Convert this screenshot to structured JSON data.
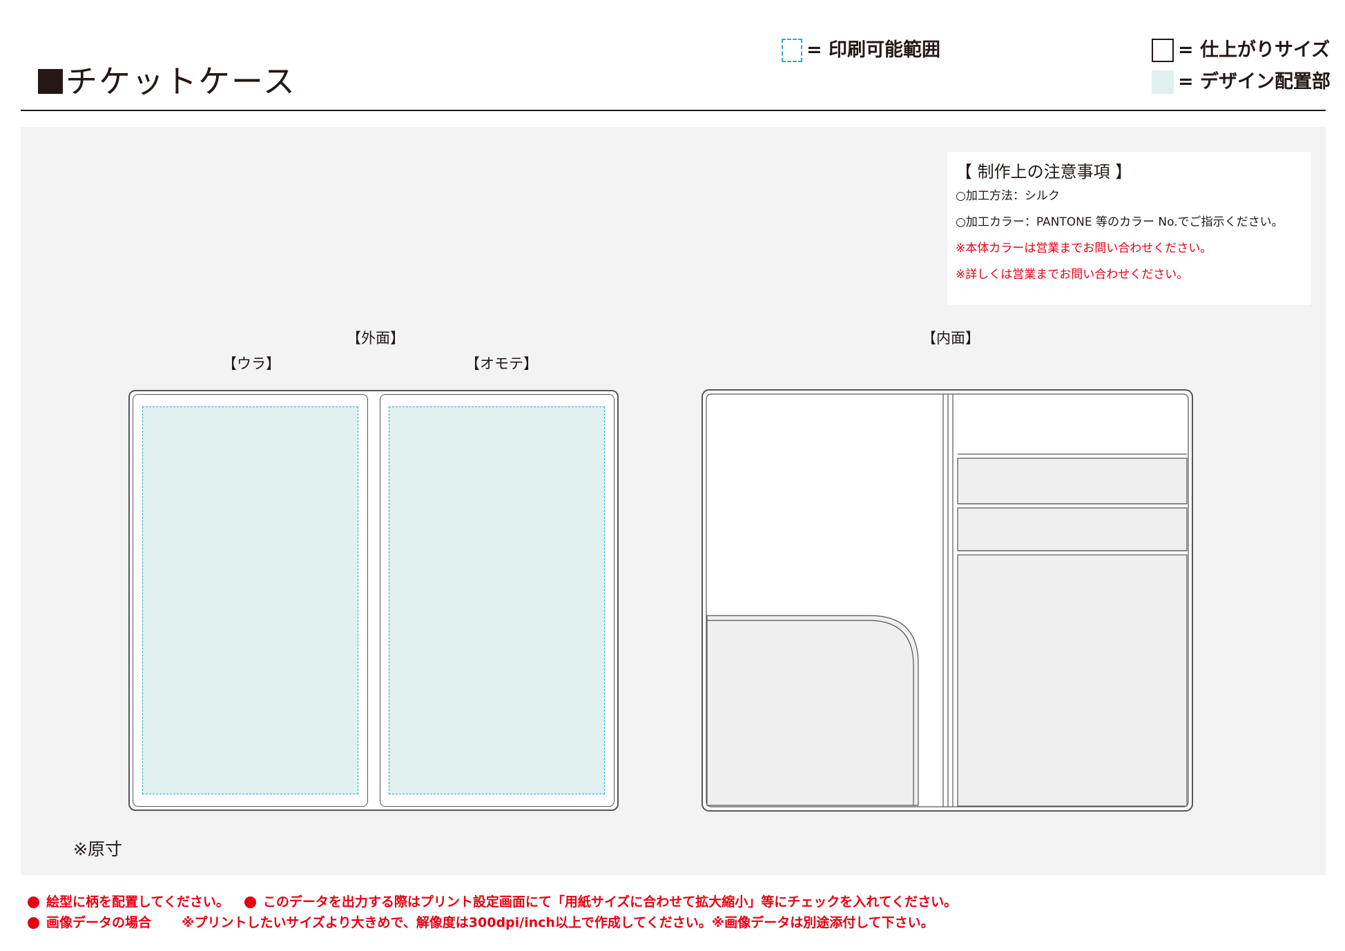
{
  "header": {
    "title": "チケットケース"
  },
  "legend": {
    "print_area": "= 印刷可能範囲",
    "finish_size": "= 仕上がりサイズ",
    "design_area": "= デザイン配置部"
  },
  "notes": {
    "title": "【 制作上の注意事項 】",
    "lines": [
      "○加工方法：シルク",
      "○加工カラー：PANTONE 等のカラー No.でご指示ください。"
    ],
    "warnings": [
      "※本体カラーは営業までお問い合わせください。",
      "※詳しくは営業までお問い合わせください。"
    ]
  },
  "labels": {
    "outer": "【外面】",
    "back": "【ウラ】",
    "front": "【オモテ】",
    "inner": "【内面】",
    "actual_size": "※原寸"
  },
  "colors": {
    "design_fill": "#dff0ee",
    "print_area_line": "#29a9d6",
    "warning_red": "#e60012"
  },
  "footer": {
    "line1_a": "絵型に柄を配置してください。",
    "line1_b": "このデータを出力する際はプリント設定画面にて「用紙サイズに合わせて拡大縮小」等にチェックを入れてください。",
    "line2_a": "画像データの場合",
    "line2_b": "※プリントしたいサイズより大きめで、解像度は300dpi/inch以上で作成してください。※画像データは別途添付して下さい。"
  }
}
